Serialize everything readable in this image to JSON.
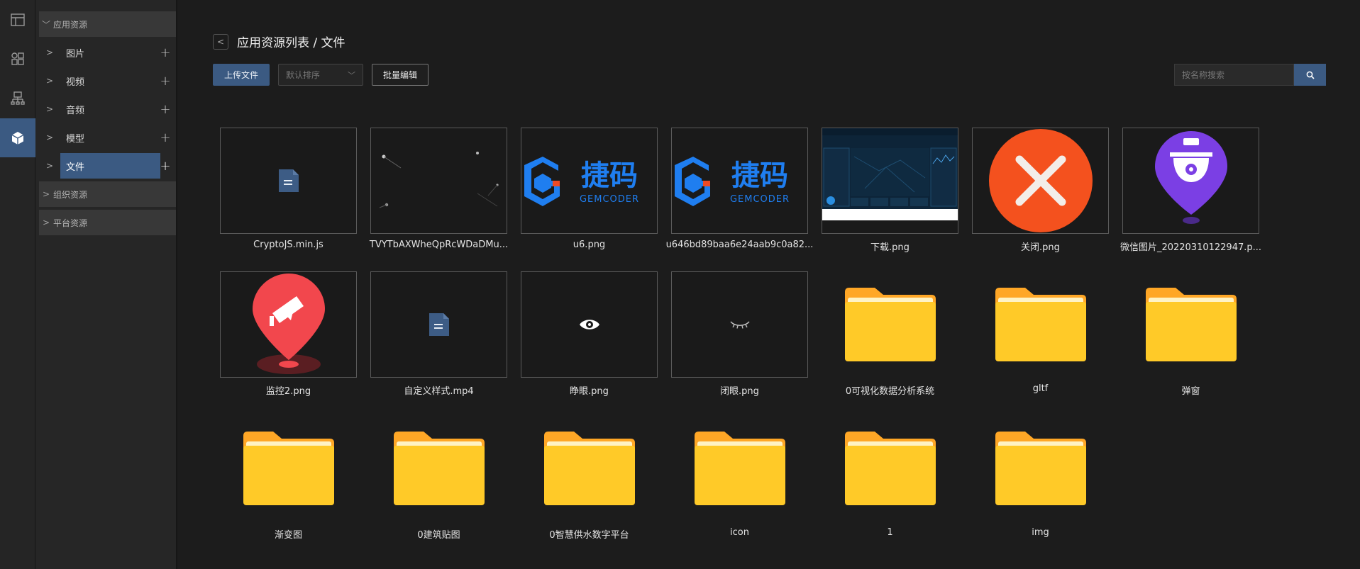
{
  "sidebar": {
    "groups": [
      {
        "label": "应用资源",
        "expanded": true
      },
      {
        "label": "组织资源",
        "expanded": false
      },
      {
        "label": "平台资源",
        "expanded": false
      }
    ],
    "items": [
      {
        "label": "图片"
      },
      {
        "label": "视频"
      },
      {
        "label": "音频"
      },
      {
        "label": "模型"
      },
      {
        "label": "文件",
        "selected": true
      }
    ]
  },
  "rail": {
    "icons": [
      "layout-icon",
      "apps-icon",
      "sitemap-icon",
      "cube-icon"
    ],
    "active_index": 3
  },
  "header": {
    "breadcrumb": "应用资源列表 / 文件"
  },
  "toolbar": {
    "upload_label": "上传文件",
    "sort_placeholder": "默认排序",
    "batch_label": "批量编辑",
    "search_placeholder": "按名称搜索"
  },
  "files": [
    {
      "name": "CryptoJS.min.js",
      "kind": "doc"
    },
    {
      "name": "TVYTbAXWheQpRcWDaDMu...",
      "kind": "particles"
    },
    {
      "name": "u6.png",
      "kind": "gemcoder"
    },
    {
      "name": "u646bd89baa6e24aab9c0a82...",
      "kind": "gemcoder"
    },
    {
      "name": "下载.png",
      "kind": "dashboard"
    },
    {
      "name": "关闭.png",
      "kind": "close"
    },
    {
      "name": "微信图片_20220310122947.p...",
      "kind": "camera-pin"
    },
    {
      "name": "监控2.png",
      "kind": "monitor-pin"
    },
    {
      "name": "自定义样式.mp4",
      "kind": "doc"
    },
    {
      "name": "睁眼.png",
      "kind": "eye-open"
    },
    {
      "name": "闭眼.png",
      "kind": "eye-closed"
    },
    {
      "name": "0可视化数据分析系统",
      "kind": "folder"
    },
    {
      "name": "gltf",
      "kind": "folder"
    },
    {
      "name": "弹窗",
      "kind": "folder"
    },
    {
      "name": "渐变图",
      "kind": "folder"
    },
    {
      "name": "0建筑贴图",
      "kind": "folder"
    },
    {
      "name": "0智慧供水数字平台",
      "kind": "folder"
    },
    {
      "name": "icon",
      "kind": "folder"
    },
    {
      "name": "1",
      "kind": "folder"
    },
    {
      "name": "img",
      "kind": "folder"
    }
  ],
  "logo_text": {
    "cn": "捷码",
    "en": "GEMCODER"
  },
  "colors": {
    "accent": "#3b5a82",
    "folder": "#ffca28",
    "close_icon": "#f4511e",
    "pin_purple": "#7b3fe4",
    "pin_red": "#f2474d",
    "gemcoder_blue": "#1f7ef0"
  }
}
